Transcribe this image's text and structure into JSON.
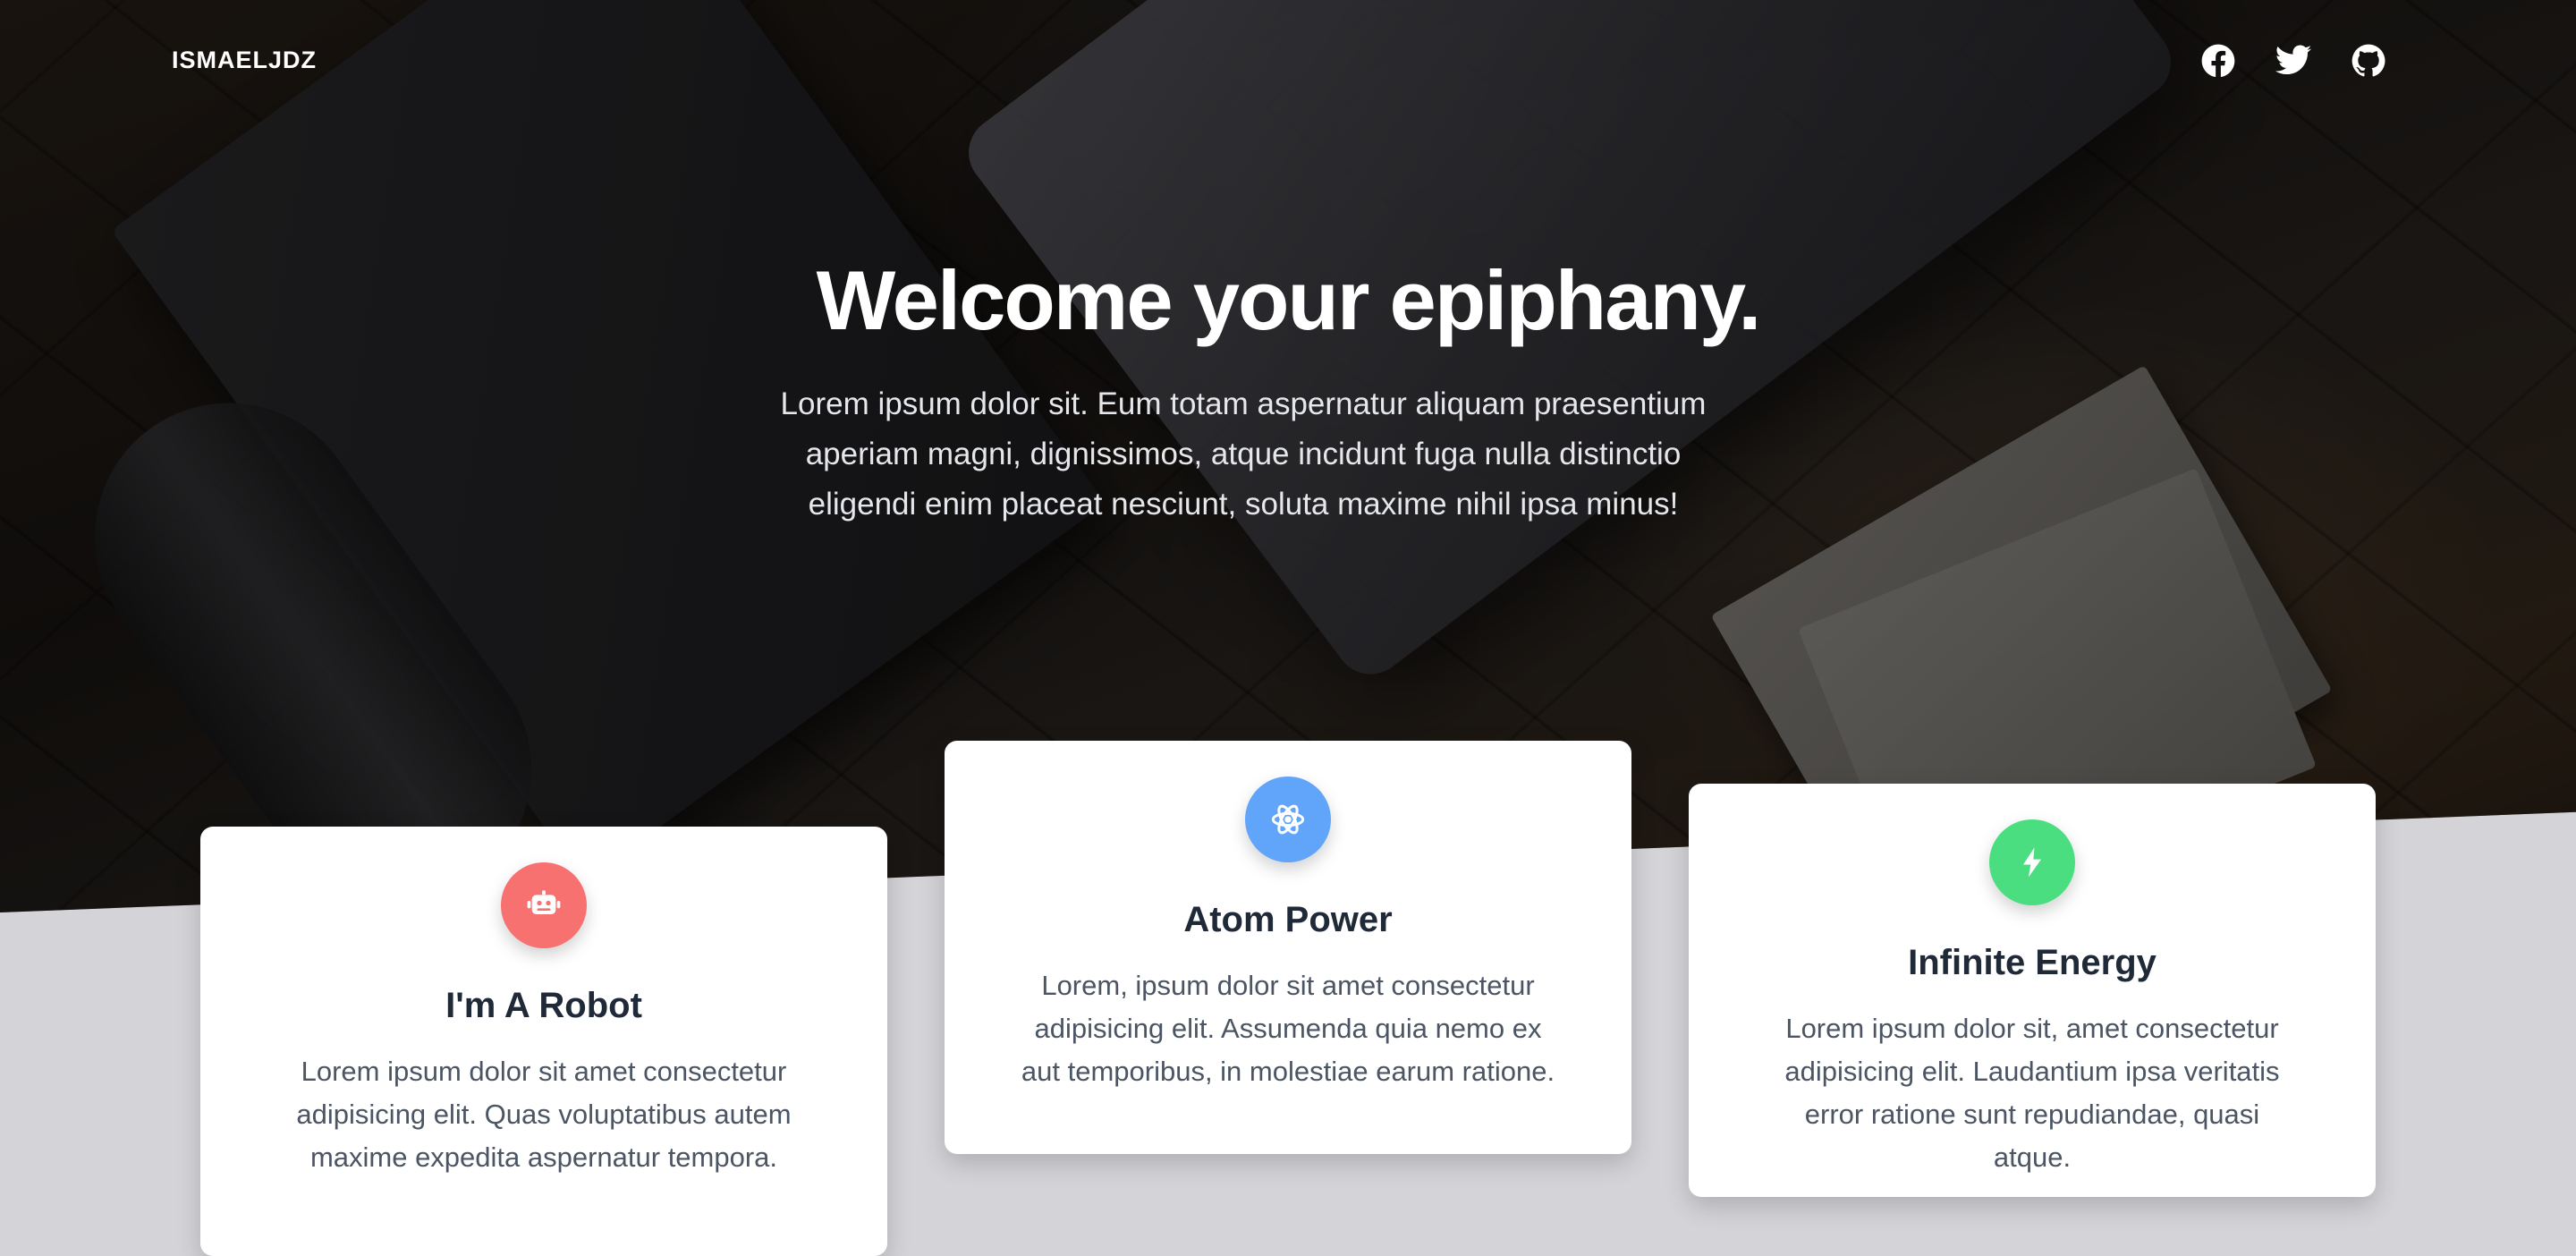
{
  "nav": {
    "brand": "ISMAELJDZ",
    "social": [
      {
        "icon": "facebook-icon"
      },
      {
        "icon": "twitter-icon"
      },
      {
        "icon": "github-icon"
      }
    ]
  },
  "hero": {
    "title": "Welcome your epiphany.",
    "subtitle": "Lorem ipsum dolor sit. Eum totam aspernatur aliquam praesentium aperiam magni, dignissimos, atque incidunt fuga nulla distinctio eligendi enim placeat nesciunt, soluta maxime nihil ipsa minus!"
  },
  "cards": [
    {
      "icon": "robot-icon",
      "color": "#f87171",
      "title": "I'm A Robot",
      "text": "Lorem ipsum dolor sit amet consectetur adipisicing elit. Quas voluptatibus autem maxime expedita aspernatur tempora."
    },
    {
      "icon": "atom-icon",
      "color": "#60a5fa",
      "title": "Atom Power",
      "text": "Lorem, ipsum dolor sit amet consectetur adipisicing elit. Assumenda quia nemo ex aut temporibus, in molestiae earum ratione."
    },
    {
      "icon": "bolt-icon",
      "color": "#4ade80",
      "title": "Infinite Energy",
      "text": "Lorem ipsum dolor sit, amet consectetur adipisicing elit. Laudantium ipsa veritatis error ratione sunt repudiandae, quasi atque."
    }
  ],
  "colors": {
    "page_background": "#d4d4d8",
    "card_background": "#ffffff",
    "heading_text": "#1f2937",
    "body_text": "#4b5563"
  }
}
